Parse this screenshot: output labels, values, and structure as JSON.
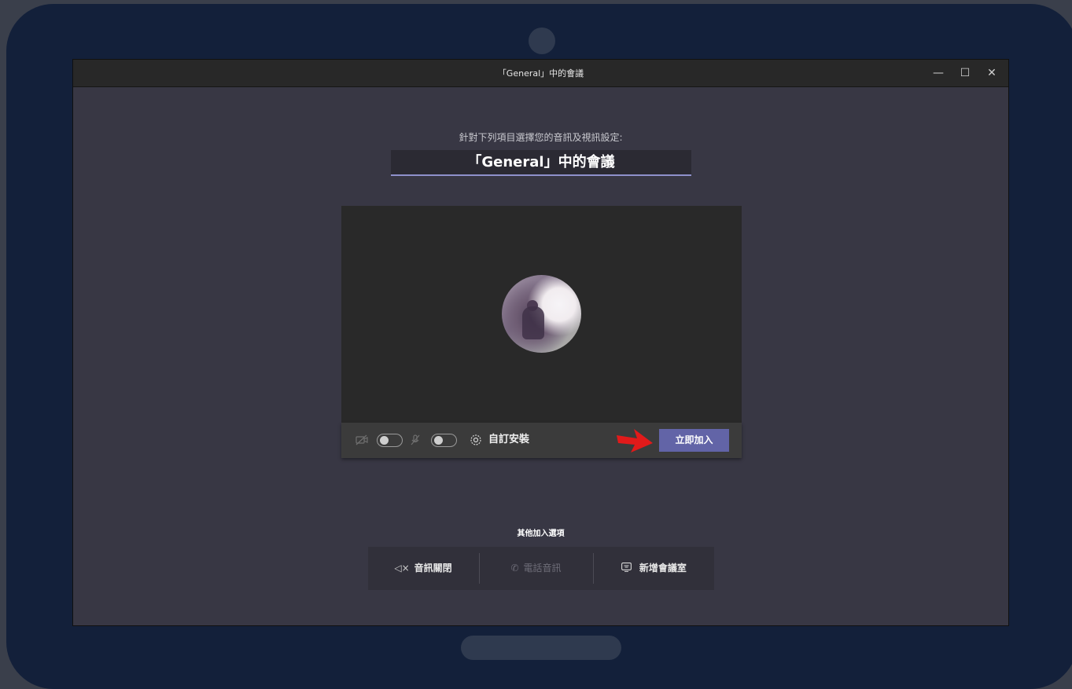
{
  "window": {
    "title": "「General」中的會議",
    "controls": {
      "minimize": "—",
      "maximize": "☐",
      "close": "✕"
    }
  },
  "prejoin": {
    "prompt": "針對下列項目選擇您的音訊及視訊設定:",
    "meeting_name": "「General」中的會議",
    "camera_toggle": "off",
    "mic_toggle": "off",
    "custom_setup_label": "自訂安裝",
    "join_button_label": "立即加入"
  },
  "other_options": {
    "title": "其他加入選項",
    "items": [
      {
        "label": "音訊關閉",
        "icon": "speaker-muted-icon",
        "enabled": true
      },
      {
        "label": "電話音訊",
        "icon": "phone-icon",
        "enabled": false
      },
      {
        "label": "新增會議室",
        "icon": "room-display-icon",
        "enabled": true
      }
    ]
  },
  "colors": {
    "accent": "#6264a7",
    "arrow": "#e11a1a",
    "window_bg": "#383744",
    "device_frame": "#13203a"
  }
}
